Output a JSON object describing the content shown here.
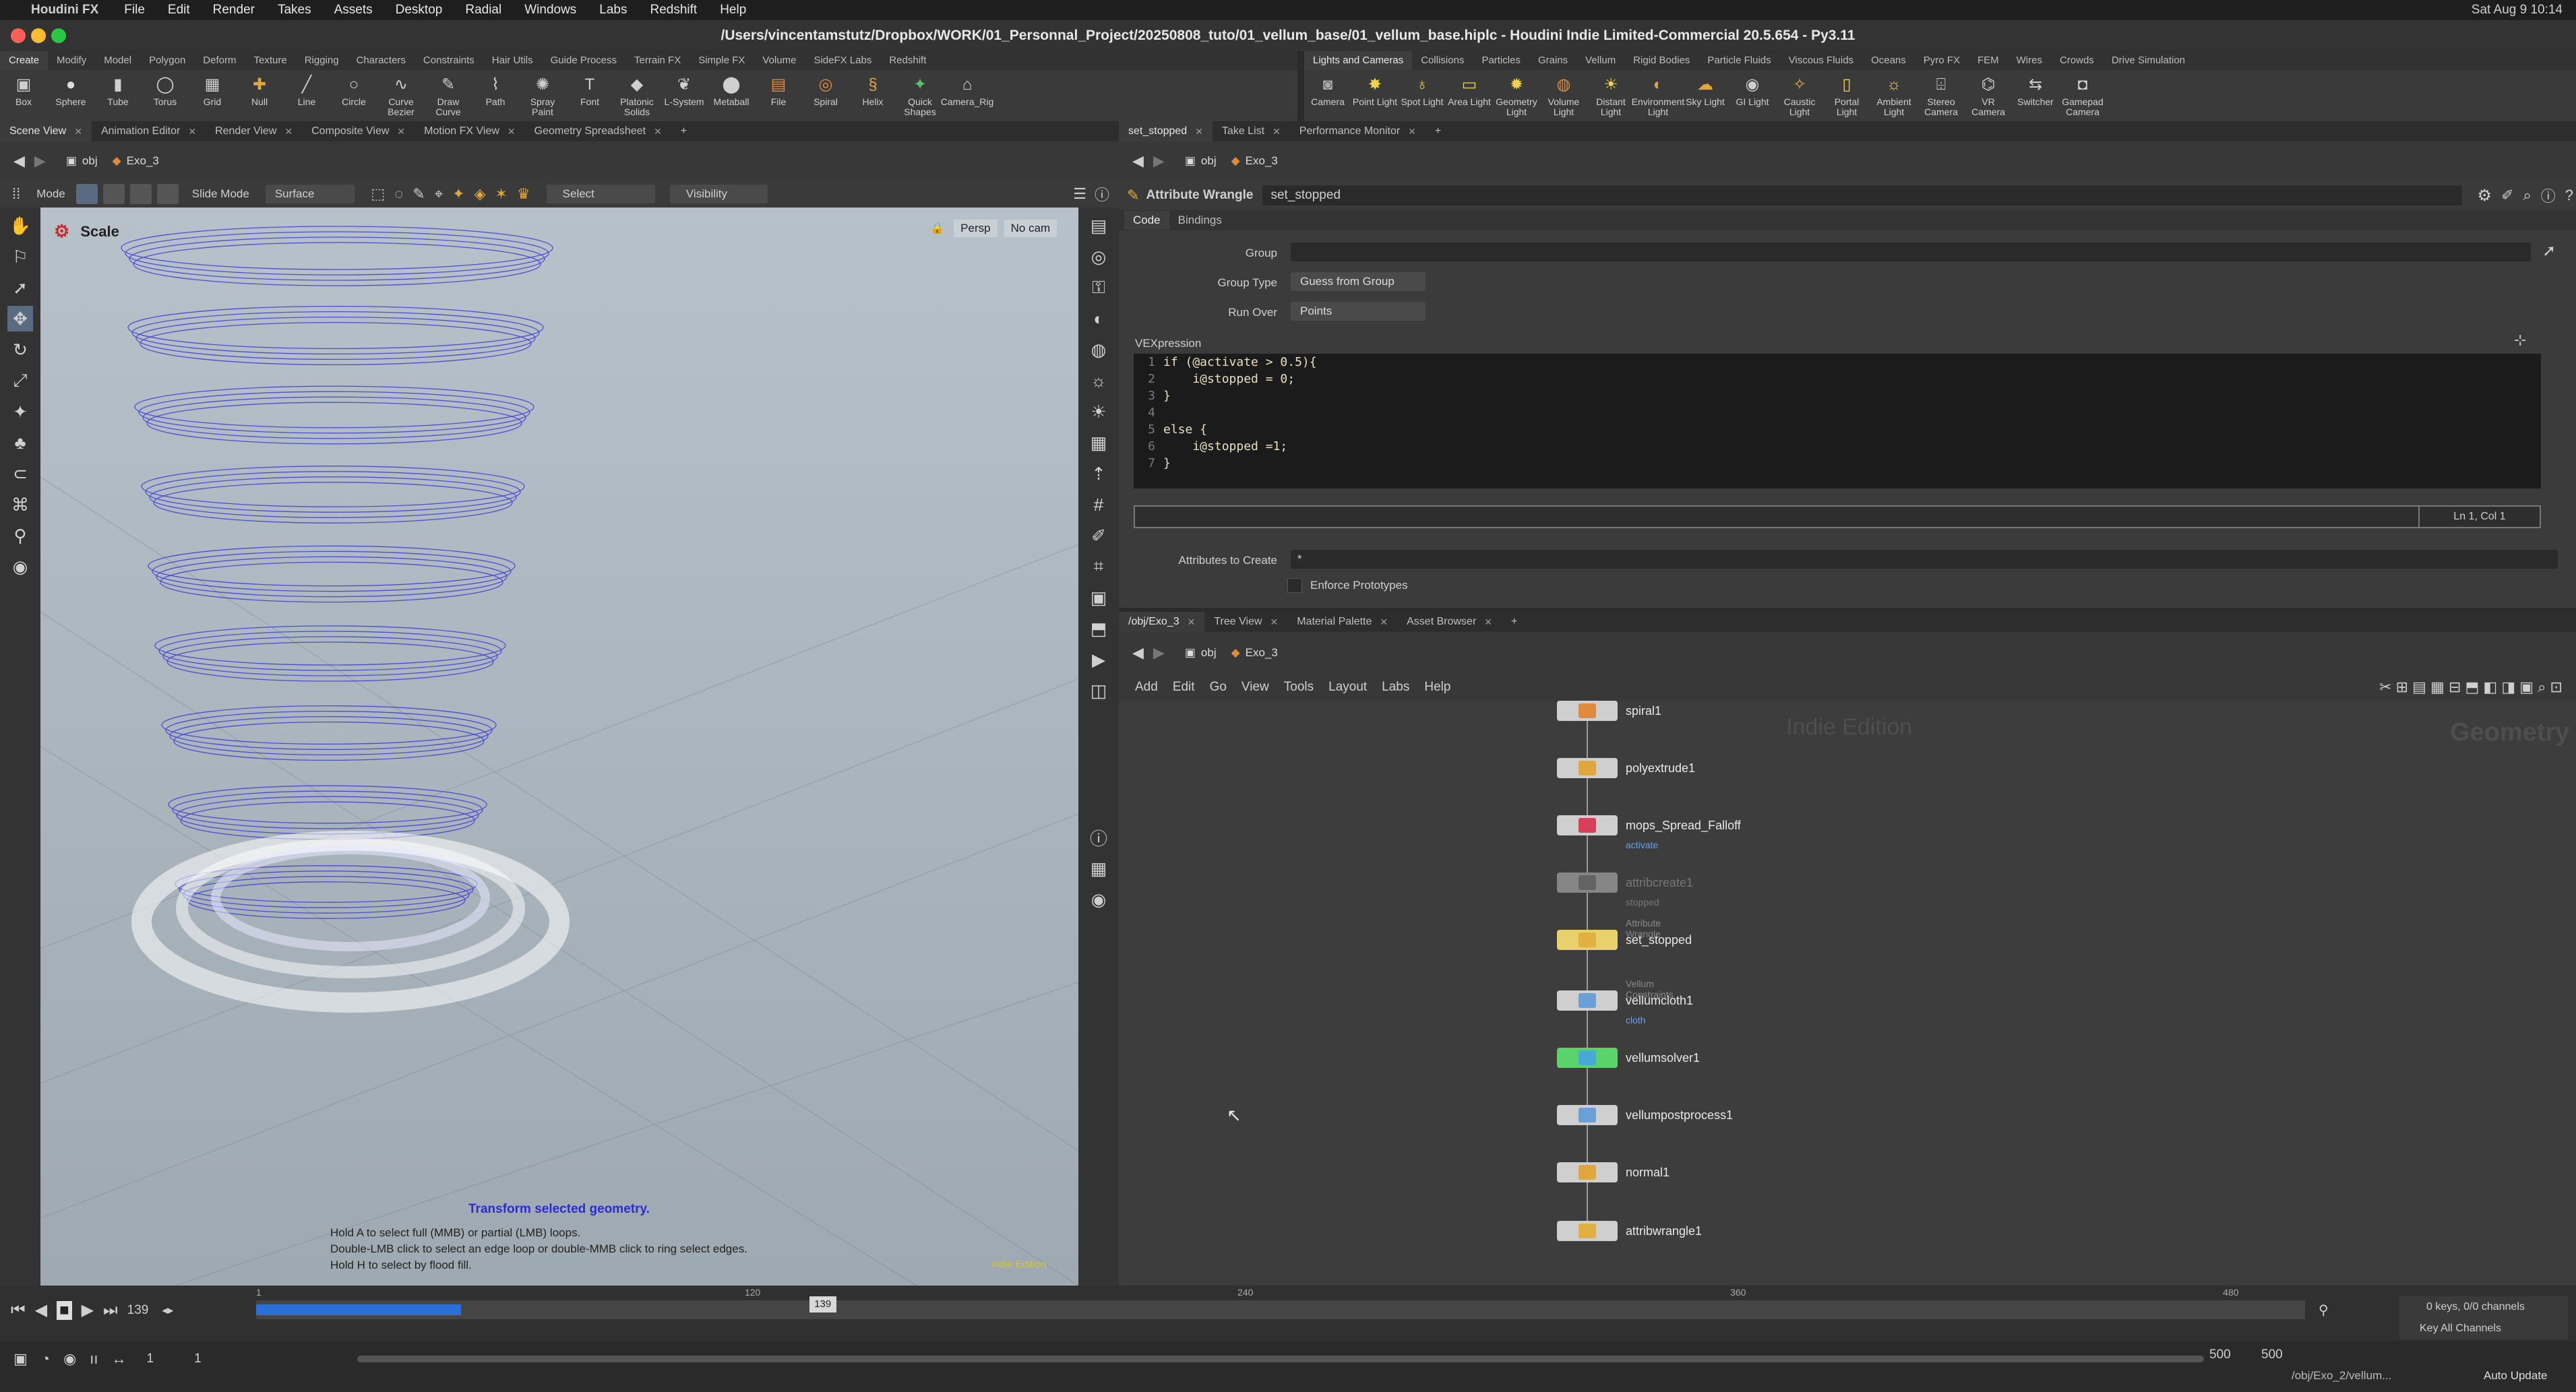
{
  "menubar": {
    "app": "Houdini FX",
    "items": [
      "File",
      "Edit",
      "Render",
      "Takes",
      "Assets",
      "Desktop",
      "Radial",
      "Windows",
      "Labs",
      "Redshift",
      "Help"
    ],
    "clock": "Sat Aug 9  10:14"
  },
  "window": {
    "title": "/Users/vincentamstutz/Dropbox/WORK/01_Personnal_Project/20250808_tuto/01_vellum_base/01_vellum_base.hiplc - Houdini Indie Limited-Commercial 20.5.654 - Py3.11"
  },
  "shelf_left": {
    "tabs": [
      "Create",
      "Modify",
      "Model",
      "Polygon",
      "Deform",
      "Texture",
      "Rigging",
      "Characters",
      "Constraints",
      "Hair Utils",
      "Guide Process",
      "Terrain FX",
      "Simple FX",
      "Volume",
      "SideFX Labs",
      "Redshift"
    ],
    "tools": [
      {
        "label": "Box",
        "icon": "box-icon"
      },
      {
        "label": "Sphere",
        "icon": "sphere-icon"
      },
      {
        "label": "Tube",
        "icon": "tube-icon"
      },
      {
        "label": "Torus",
        "icon": "torus-icon"
      },
      {
        "label": "Grid",
        "icon": "grid-icon"
      },
      {
        "label": "Null",
        "icon": "null-icon"
      },
      {
        "label": "Line",
        "icon": "line-icon"
      },
      {
        "label": "Circle",
        "icon": "circle-icon"
      },
      {
        "label": "Curve Bezier",
        "icon": "curve-bezier-icon"
      },
      {
        "label": "Draw Curve",
        "icon": "draw-curve-icon"
      },
      {
        "label": "Path",
        "icon": "path-icon"
      },
      {
        "label": "Spray Paint",
        "icon": "spray-paint-icon"
      },
      {
        "label": "Font",
        "icon": "font-icon"
      },
      {
        "label": "Platonic Solids",
        "icon": "platonic-icon"
      },
      {
        "label": "L-System",
        "icon": "lsystem-icon"
      },
      {
        "label": "Metaball",
        "icon": "metaball-icon"
      },
      {
        "label": "File",
        "icon": "file-icon"
      },
      {
        "label": "Spiral",
        "icon": "spiral-icon"
      },
      {
        "label": "Helix",
        "icon": "helix-icon"
      },
      {
        "label": "Quick Shapes",
        "icon": "quick-shapes-icon"
      },
      {
        "label": "Camera_Rig",
        "icon": "camera-rig-icon"
      }
    ]
  },
  "shelf_right": {
    "tabs": [
      "Lights and Cameras",
      "Collisions",
      "Particles",
      "Grains",
      "Vellum",
      "Rigid Bodies",
      "Particle Fluids",
      "Viscous Fluids",
      "Oceans",
      "Pyro FX",
      "FEM",
      "Wires",
      "Crowds",
      "Drive Simulation"
    ],
    "tools": [
      {
        "label": "Camera",
        "icon": "camera-icon"
      },
      {
        "label": "Point Light",
        "icon": "point-light-icon"
      },
      {
        "label": "Spot Light",
        "icon": "spot-light-icon"
      },
      {
        "label": "Area Light",
        "icon": "area-light-icon"
      },
      {
        "label": "Geometry Light",
        "icon": "geometry-light-icon"
      },
      {
        "label": "Volume Light",
        "icon": "volume-light-icon"
      },
      {
        "label": "Distant Light",
        "icon": "distant-light-icon"
      },
      {
        "label": "Environment Light",
        "icon": "environment-light-icon"
      },
      {
        "label": "Sky Light",
        "icon": "sky-light-icon"
      },
      {
        "label": "GI Light",
        "icon": "gi-light-icon"
      },
      {
        "label": "Caustic Light",
        "icon": "caustic-light-icon"
      },
      {
        "label": "Portal Light",
        "icon": "portal-light-icon"
      },
      {
        "label": "Ambient Light",
        "icon": "ambient-light-icon"
      },
      {
        "label": "Stereo Camera",
        "icon": "stereo-camera-icon"
      },
      {
        "label": "VR Camera",
        "icon": "vr-camera-icon"
      },
      {
        "label": "Switcher",
        "icon": "switcher-icon"
      },
      {
        "label": "Gamepad Camera",
        "icon": "gamepad-camera-icon"
      }
    ]
  },
  "left_pane": {
    "tabs": [
      "Scene View",
      "Animation Editor",
      "Render View",
      "Composite View",
      "Motion FX View",
      "Geometry Spreadsheet"
    ],
    "path": [
      "obj",
      "Exo_3"
    ],
    "toolbar": {
      "mode": "Mode",
      "slide": "Slide Mode",
      "surface": "Surface",
      "select": "Select",
      "visibility": "Visibility"
    },
    "viewport": {
      "tool_name": "Scale",
      "persp": "Persp",
      "cam": "No cam",
      "hint_title": "Transform selected geometry.",
      "hint_lines": [
        "Hold A to select full (MMB) or partial (LMB) loops.",
        "Double-LMB click to select an edge loop or double-MMB click to ring select edges.",
        "Hold H to select by flood fill."
      ],
      "edition": "Indie Edition"
    }
  },
  "param_pane": {
    "tabs": [
      "set_stopped",
      "Take List",
      "Performance Monitor"
    ],
    "path": [
      "obj",
      "Exo_3"
    ],
    "node_type": "Attribute Wrangle",
    "node_name": "set_stopped",
    "subtabs": [
      "Code",
      "Bindings"
    ],
    "fields": {
      "group_label": "Group",
      "group_value": "",
      "group_type_label": "Group Type",
      "group_type_value": "Guess from Group",
      "run_over_label": "Run Over",
      "run_over_value": "Points",
      "vex_label": "VEXpression",
      "cursor": "Ln 1, Col 1",
      "attrs_label": "Attributes to Create",
      "attrs_value": "*",
      "enforce_label": "Enforce Prototypes"
    },
    "code": [
      "if (@activate > 0.5){",
      "    i@stopped = 0;",
      "}",
      "",
      "else {",
      "    i@stopped =1;",
      "}"
    ]
  },
  "network_pane": {
    "tabs": [
      "/obj/Exo_3",
      "Tree View",
      "Material Palette",
      "Asset Browser"
    ],
    "path": [
      "obj",
      "Exo_3"
    ],
    "menu": [
      "Add",
      "Edit",
      "Go",
      "View",
      "Tools",
      "Layout",
      "Labs",
      "Help"
    ],
    "watermark": "Indie Edition",
    "context": "Geometry",
    "nodes": [
      {
        "name": "spiral1",
        "sub": "",
        "color": "#e08a3c"
      },
      {
        "name": "polyextrude1",
        "sub": "",
        "color": "#e0a83c"
      },
      {
        "name": "mops_Spread_Falloff",
        "sub": "activate",
        "color": "#d8405a"
      },
      {
        "name": "attribcreate1",
        "sub": "stopped",
        "color": "#8a8a8a"
      },
      {
        "name": "set_stopped",
        "sub": "",
        "color": "#e0b040"
      },
      {
        "name": "vellumcloth1",
        "sub": "cloth",
        "color": "#6aa0d8"
      },
      {
        "name": "vellumsolver1",
        "sub": "",
        "color": "#4aa8d8"
      },
      {
        "name": "vellumpostprocess1",
        "sub": "",
        "color": "#6aa0d8"
      },
      {
        "name": "normal1",
        "sub": "",
        "color": "#e0a83c"
      },
      {
        "name": "attribwrangle1",
        "sub": "",
        "color": "#e0b040"
      }
    ],
    "node_type_labels": {
      "set_stopped": "Attribute Wrangle",
      "vellumcloth1": "Vellum Constraints"
    }
  },
  "timeline": {
    "frame": "139",
    "ticks": [
      "1",
      "120",
      "240",
      "360",
      "480"
    ],
    "start": "1",
    "start2": "1",
    "end": "500",
    "end2": "500",
    "keys": "0 keys, 0/0 channels",
    "key_all": "Key All Channels",
    "status_path": "/obj/Exo_2/vellum...",
    "auto_update": "Auto Update",
    "progress": 0.09
  }
}
